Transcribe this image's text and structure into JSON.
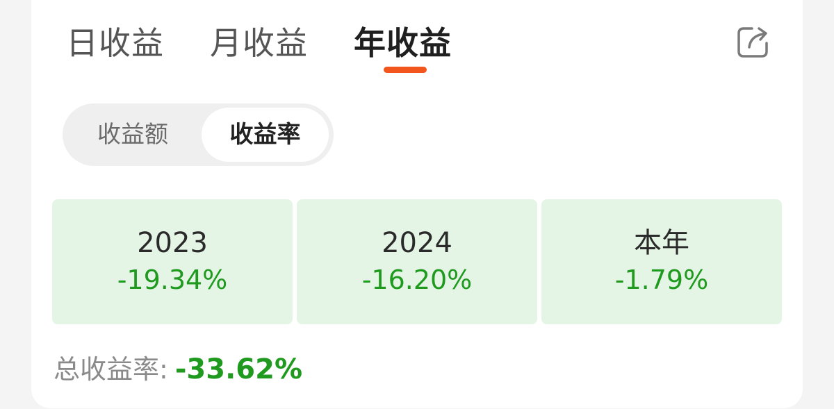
{
  "tabs": [
    {
      "label": "日收益"
    },
    {
      "label": "月收益"
    },
    {
      "label": "年收益"
    }
  ],
  "active_tab_index": 2,
  "share_icon": "share-export-icon",
  "segment": {
    "options": [
      "收益额",
      "收益率"
    ],
    "selected_index": 1
  },
  "stats": [
    {
      "label": "2023",
      "value": "-19.34%"
    },
    {
      "label": "2024",
      "value": "-16.20%"
    },
    {
      "label": "本年",
      "value": "-1.79%"
    }
  ],
  "total": {
    "label": "总收益率:",
    "value": "-33.62%"
  },
  "colors": {
    "accent": "#f2561d",
    "negative_green": "#1f9a1f",
    "stat_bg": "#e4f5e6"
  }
}
